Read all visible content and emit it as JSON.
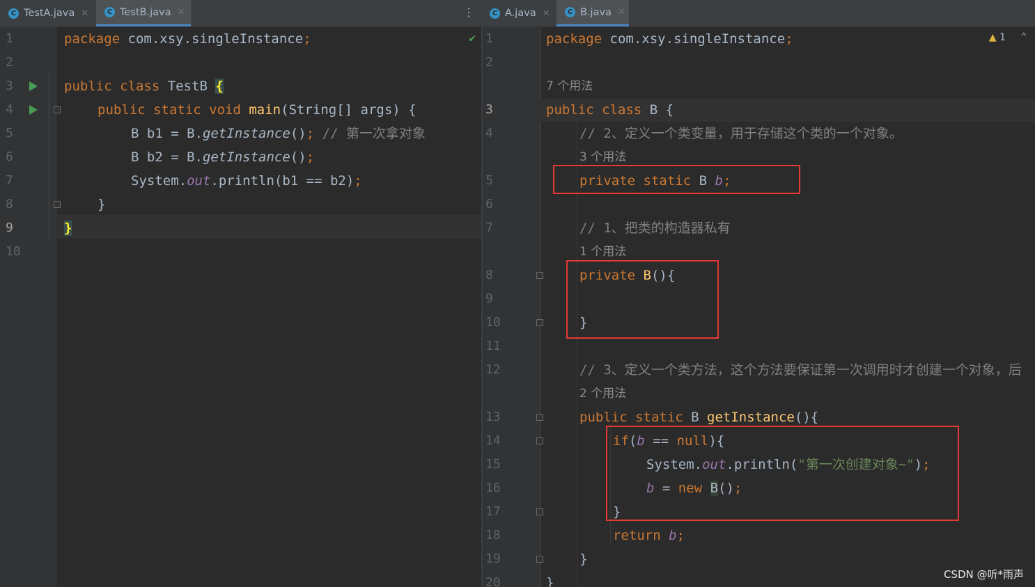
{
  "left_pane": {
    "tabs": [
      {
        "label": "TestA.java",
        "icon": "class-c-icon"
      },
      {
        "label": "TestB.java",
        "icon": "class-c-icon"
      }
    ],
    "lines": [
      {
        "num": "1"
      },
      {
        "num": "2"
      },
      {
        "num": "3"
      },
      {
        "num": "4"
      },
      {
        "num": "5"
      },
      {
        "num": "6"
      },
      {
        "num": "7"
      },
      {
        "num": "8"
      },
      {
        "num": "9"
      },
      {
        "num": "10"
      }
    ],
    "code": {
      "l1_kw": "package",
      "l1_rest": " com.xsy.singleInstance",
      "l1_semi": ";",
      "l3_kw": "public class",
      "l3_name": " TestB ",
      "l3_brace": "{",
      "l4_kw": "public static void",
      "l4_fn": "main",
      "l4_rest": "(String[] args) {",
      "l5_a": "B b1 = B.",
      "l5_call": "getInstance",
      "l5_b": "()",
      "l5_semi": ";",
      "l5_comment": " // 第一次拿对象",
      "l6_a": "B b2 = B.",
      "l6_call": "getInstance",
      "l6_b": "()",
      "l6_semi": ";",
      "l7_a": "System.",
      "l7_out": "out",
      "l7_b": ".println(b1 == b2)",
      "l7_semi": ";",
      "l8": "}",
      "l9_brace": "}"
    }
  },
  "right_pane": {
    "tabs": [
      {
        "label": "A.java",
        "icon": "class-c-icon"
      },
      {
        "label": "B.java",
        "icon": "class-c-icon"
      }
    ],
    "warning_count": "1",
    "lines": [
      {
        "num": "1"
      },
      {
        "num": "2"
      },
      {
        "num": "3"
      },
      {
        "num": "4"
      },
      {
        "num": "5"
      },
      {
        "num": "6"
      },
      {
        "num": "7"
      },
      {
        "num": "8"
      },
      {
        "num": "9"
      },
      {
        "num": "10"
      },
      {
        "num": "11"
      },
      {
        "num": "12"
      },
      {
        "num": "13"
      },
      {
        "num": "14"
      },
      {
        "num": "15"
      },
      {
        "num": "16"
      },
      {
        "num": "17"
      },
      {
        "num": "18"
      },
      {
        "num": "19"
      },
      {
        "num": "20"
      }
    ],
    "hints": {
      "class_usages": "7 个用法",
      "field_usages": "3 个用法",
      "ctor_usages": "1 个用法",
      "method_usages": "2 个用法"
    },
    "code": {
      "l1_kw": "package",
      "l1_rest": " com.xsy.singleInstance",
      "l1_semi": ";",
      "l3_kw": "public class",
      "l3_rest": " B {",
      "l4_comment": "// 2、定义一个类变量，用于存储这个类的一个对象。",
      "l5_kw": "private static",
      "l5_type": " B ",
      "l5_field": "b",
      "l5_semi": ";",
      "l7_comment": "// 1、把类的构造器私有",
      "l8_kw": "private",
      "l8_fn": " B",
      "l8_rest": "(){",
      "l10": "}",
      "l12_comment": "// 3、定义一个类方法，这个方法要保证第一次调用时才创建一个对象，后",
      "l13_kw": "public static",
      "l13_type": " B ",
      "l13_fn": "getInstance",
      "l13_rest": "(){",
      "l14_kw": "if",
      "l14_a": "(",
      "l14_field": "b",
      "l14_b": " == ",
      "l14_null": "null",
      "l14_c": "){",
      "l15_a": "System.",
      "l15_out": "out",
      "l15_b": ".println(",
      "l15_str": "\"第一次创建对象~\"",
      "l15_c": ")",
      "l15_semi": ";",
      "l16_field": "b",
      "l16_a": " = ",
      "l16_new": "new",
      "l16_b": " ",
      "l16_cls": "B",
      "l16_c": "()",
      "l16_semi": ";",
      "l17": "}",
      "l18_kw": "return",
      "l18_field": " b",
      "l18_semi": ";",
      "l19": "}",
      "l20": "}"
    }
  },
  "watermark": "CSDN @听*雨声"
}
